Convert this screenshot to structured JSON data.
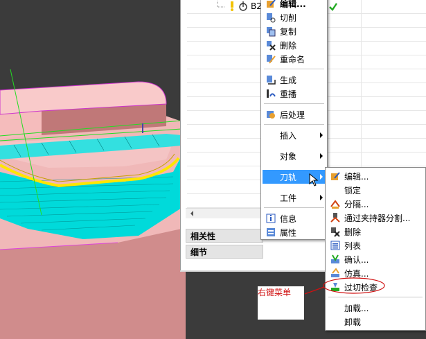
{
  "tree": {
    "item_label": "B2"
  },
  "context_menu": {
    "items": [
      {
        "label": "编辑...",
        "icon": "edit-icon"
      },
      {
        "label": "切削",
        "icon": "cut-icon"
      },
      {
        "label": "复制",
        "icon": "copy-icon"
      },
      {
        "label": "删除",
        "icon": "delete-icon"
      },
      {
        "label": "重命名",
        "icon": "rename-icon"
      },
      {
        "label": "生成",
        "icon": "generate-icon"
      },
      {
        "label": "重播",
        "icon": "replay-icon"
      },
      {
        "label": "后处理",
        "icon": "postprocess-icon"
      },
      {
        "label": "插入",
        "icon": ""
      },
      {
        "label": "对象",
        "icon": ""
      },
      {
        "label": "刀轨",
        "icon": ""
      },
      {
        "label": "工件",
        "icon": ""
      },
      {
        "label": "信息",
        "icon": "info-icon"
      },
      {
        "label": "属性",
        "icon": "properties-icon"
      }
    ]
  },
  "submenu": {
    "items": [
      {
        "label": "编辑...",
        "icon": "edit-path-icon"
      },
      {
        "label": "锁定",
        "icon": ""
      },
      {
        "label": "分隔...",
        "icon": "split-icon"
      },
      {
        "label": "通过夹持器分割...",
        "icon": "holder-split-icon"
      },
      {
        "label": "删除",
        "icon": "delete-path-icon"
      },
      {
        "label": "列表",
        "icon": "list-icon"
      },
      {
        "label": "确认...",
        "icon": "verify-icon"
      },
      {
        "label": "仿真...",
        "icon": "simulate-icon"
      },
      {
        "label": "过切检查",
        "icon": "gouge-check-icon"
      },
      {
        "label": "加载...",
        "icon": ""
      },
      {
        "label": "卸载",
        "icon": ""
      }
    ]
  },
  "panels": {
    "dependencies": "相关性",
    "details": "细节"
  },
  "annotation": {
    "label": "右键菜单",
    "color": "#d01010"
  },
  "colors": {
    "highlight": "#3399ff",
    "model_pink": "#f0b8b8",
    "toolpath_cyan": "#00e5e5"
  }
}
